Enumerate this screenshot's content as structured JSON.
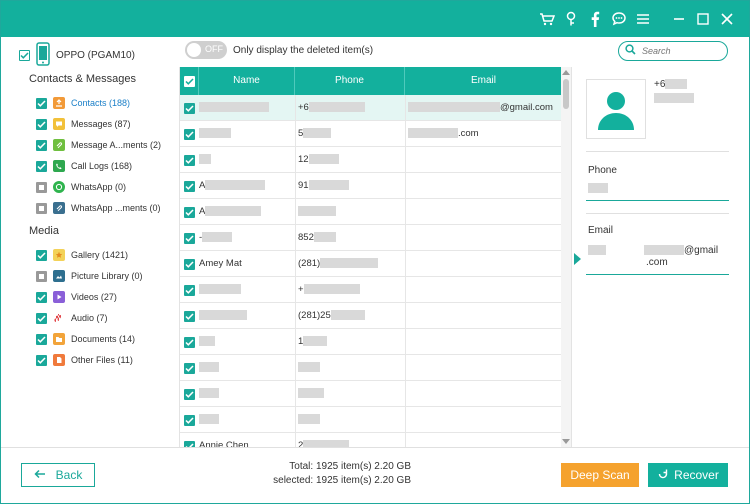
{
  "colors": {
    "accent": "#13b09d",
    "deep_scan": "#f5a22e",
    "active_link": "#1a7fc8"
  },
  "titlebar": {
    "icons": [
      "cart-icon",
      "key-icon",
      "facebook-icon",
      "chat-icon",
      "menu-icon",
      "minimize-icon",
      "maximize-icon",
      "close-icon"
    ]
  },
  "device": {
    "name": "OPPO (PGAM10)",
    "checked": true
  },
  "sections": {
    "contacts_messages": "Contacts & Messages",
    "media": "Media"
  },
  "contacts_items": [
    {
      "label": "Contacts (188)",
      "checked": true,
      "active": true
    },
    {
      "label": "Messages (87)",
      "checked": true
    },
    {
      "label": "Message A...ments (2)",
      "checked": true
    },
    {
      "label": "Call Logs (168)",
      "checked": true
    },
    {
      "label": "WhatsApp (0)",
      "checked": false
    },
    {
      "label": "WhatsApp ...ments (0)",
      "checked": false
    }
  ],
  "media_items": [
    {
      "label": "Gallery (1421)",
      "checked": true
    },
    {
      "label": "Picture Library (0)",
      "checked": false
    },
    {
      "label": "Videos (27)",
      "checked": true
    },
    {
      "label": "Audio (7)",
      "checked": true
    },
    {
      "label": "Documents (14)",
      "checked": true
    },
    {
      "label": "Other Files (11)",
      "checked": true
    }
  ],
  "toolbar": {
    "toggle_label": "OFF",
    "toggle_text": "Only display the deleted item(s)",
    "search_placeholder": "Search"
  },
  "table": {
    "headers": {
      "name": "Name",
      "phone": "Phone",
      "email": "Email"
    },
    "rows": [
      {
        "name": "",
        "phone": "+6",
        "email": "@gmail.com",
        "selected": true
      },
      {
        "name": "",
        "phone": "5",
        "email": ".com"
      },
      {
        "name": "",
        "phone": "12",
        "email": ""
      },
      {
        "name": "A",
        "phone": "91",
        "email": ""
      },
      {
        "name": "A",
        "phone": "",
        "email": ""
      },
      {
        "name": "-",
        "phone": "852",
        "email": ""
      },
      {
        "name": "Amey Mat",
        "phone": "(281)",
        "email": ""
      },
      {
        "name": "",
        "phone": "+",
        "email": ""
      },
      {
        "name": "",
        "phone": "(281)25",
        "email": ""
      },
      {
        "name": "",
        "phone": "1",
        "email": ""
      },
      {
        "name": "",
        "phone": "",
        "email": ""
      },
      {
        "name": "",
        "phone": "",
        "email": ""
      },
      {
        "name": "",
        "phone": "",
        "email": ""
      },
      {
        "name": "Annie Chen",
        "phone": "2",
        "email": ""
      }
    ]
  },
  "detail": {
    "phone_top": "+6",
    "phone_label": "Phone",
    "email_label": "Email",
    "email_value": "@gmail",
    "email_value_line2": ".com"
  },
  "footer": {
    "back": "Back",
    "total": "Total: 1925 item(s) 2.20 GB",
    "selected": "selected: 1925 item(s) 2.20 GB",
    "deep_scan": "Deep Scan",
    "recover": "Recover"
  }
}
